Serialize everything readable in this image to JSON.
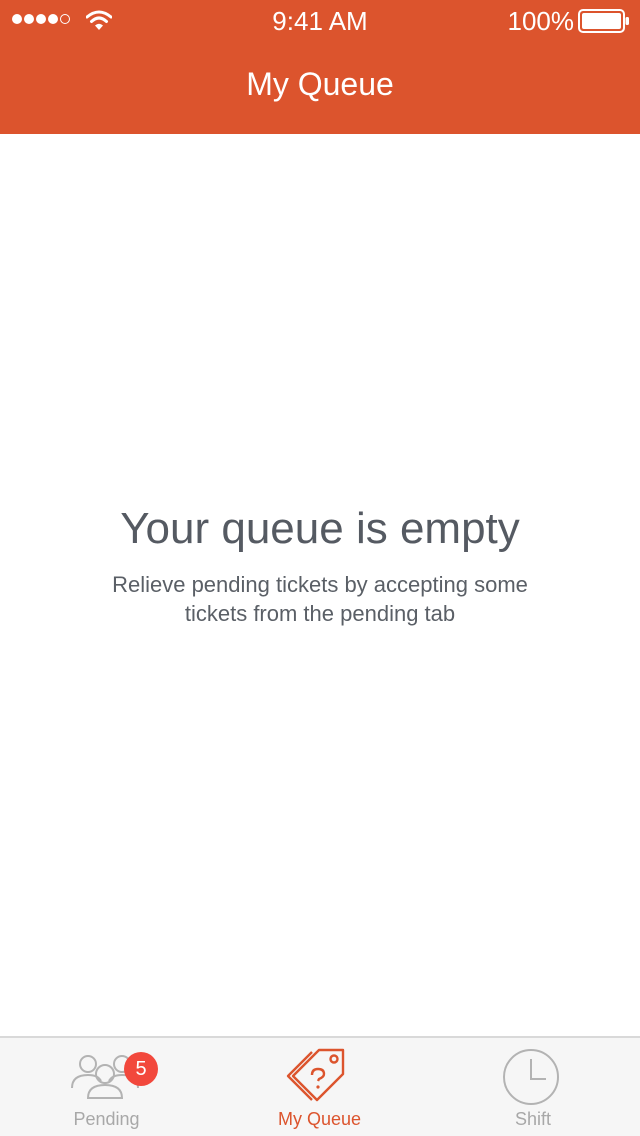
{
  "status_bar": {
    "time": "9:41 AM",
    "battery_percent": "100%",
    "signal_bars_filled": 4,
    "signal_bars_total": 5,
    "icons": [
      "signal-dots-icon",
      "wifi-icon",
      "battery-icon"
    ]
  },
  "header": {
    "title": "My Queue",
    "background_color": "#dc542d"
  },
  "empty_state": {
    "title": "Your queue is empty",
    "description": "Relieve pending tickets by accepting some tickets from the pending tab"
  },
  "tabbar": {
    "tabs": [
      {
        "label": "Pending",
        "icon": "users-group-icon",
        "badge": "5",
        "active": false
      },
      {
        "label": "My Queue",
        "icon": "tags-question-icon",
        "active": true
      },
      {
        "label": "Shift",
        "icon": "clock-icon",
        "active": false
      }
    ],
    "active_color": "#dc542d",
    "inactive_color": "#a8a8a8",
    "badge_color": "#f2483c"
  }
}
